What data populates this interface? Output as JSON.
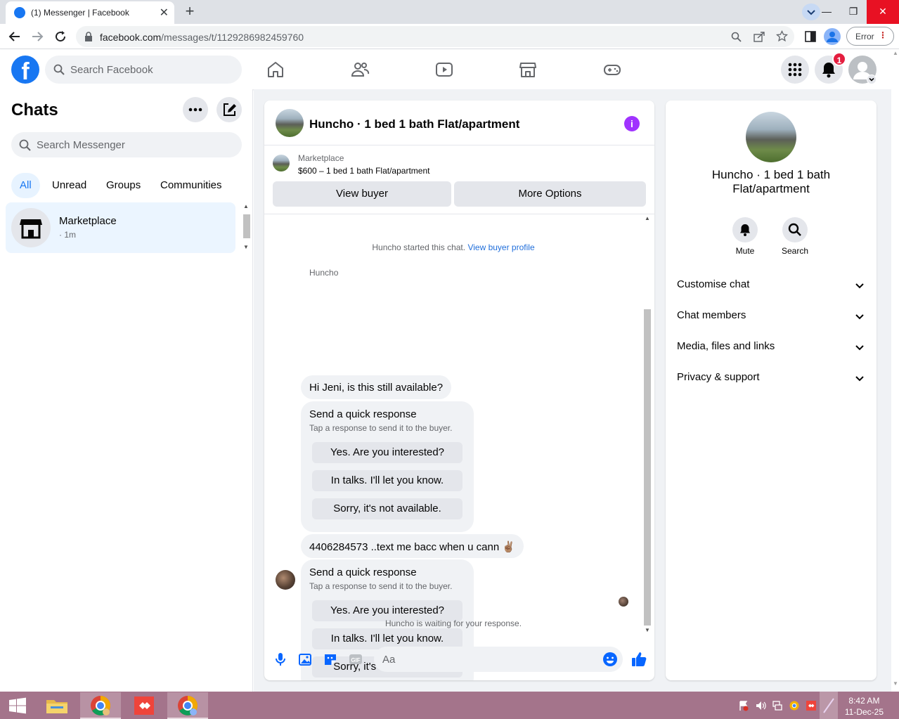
{
  "browser": {
    "tab_title": "(1) Messenger | Facebook",
    "url_host": "facebook.com",
    "url_path": "/messages/t/1129286982459760",
    "error_label": "Error"
  },
  "fb_header": {
    "search_placeholder": "Search Facebook",
    "notification_count": "1"
  },
  "left_panel": {
    "title": "Chats",
    "search_placeholder": "Search Messenger",
    "filters": [
      "All",
      "Unread",
      "Groups",
      "Communities"
    ],
    "active_filter": "All",
    "conversations": [
      {
        "name": "Marketplace",
        "time": "· 1m"
      }
    ]
  },
  "chat": {
    "title": "Huncho · 1 bed 1 bath Flat/apartment",
    "marketplace_label": "Marketplace",
    "listing_price": "$600 – 1 bed 1 bath Flat/apartment",
    "view_buyer_label": "View buyer",
    "more_options_label": "More Options",
    "started_text": "Huncho started this chat.",
    "view_profile_link": "View buyer profile",
    "sender_name": "Huncho",
    "messages": [
      {
        "text": "Hi Jeni, is this still available?"
      },
      {
        "text": "4406284573 ..text me bacc when u cann ✌🏽"
      }
    ],
    "quick_response": {
      "heading": "Send a quick response",
      "subtext": "Tap a response to send it to the buyer.",
      "options": [
        "Yes. Are you interested?",
        "In talks. I'll let you know.",
        "Sorry, it's not available."
      ]
    },
    "waiting_text": "Huncho is waiting for your response.",
    "composer_placeholder": "Aa"
  },
  "right_panel": {
    "name": "Huncho · 1 bed 1 bath Flat/apartment",
    "actions": [
      "Mute",
      "Search"
    ],
    "sections": [
      "Customise chat",
      "Chat members",
      "Media, files and links",
      "Privacy & support"
    ]
  },
  "taskbar": {
    "time": "8:42 AM",
    "date": "11-Dec-25"
  },
  "colors": {
    "brand": "#1877f2",
    "messenger_purple": "#a033ff",
    "taskbar": "#a4748b",
    "badge": "#e41e3f"
  }
}
